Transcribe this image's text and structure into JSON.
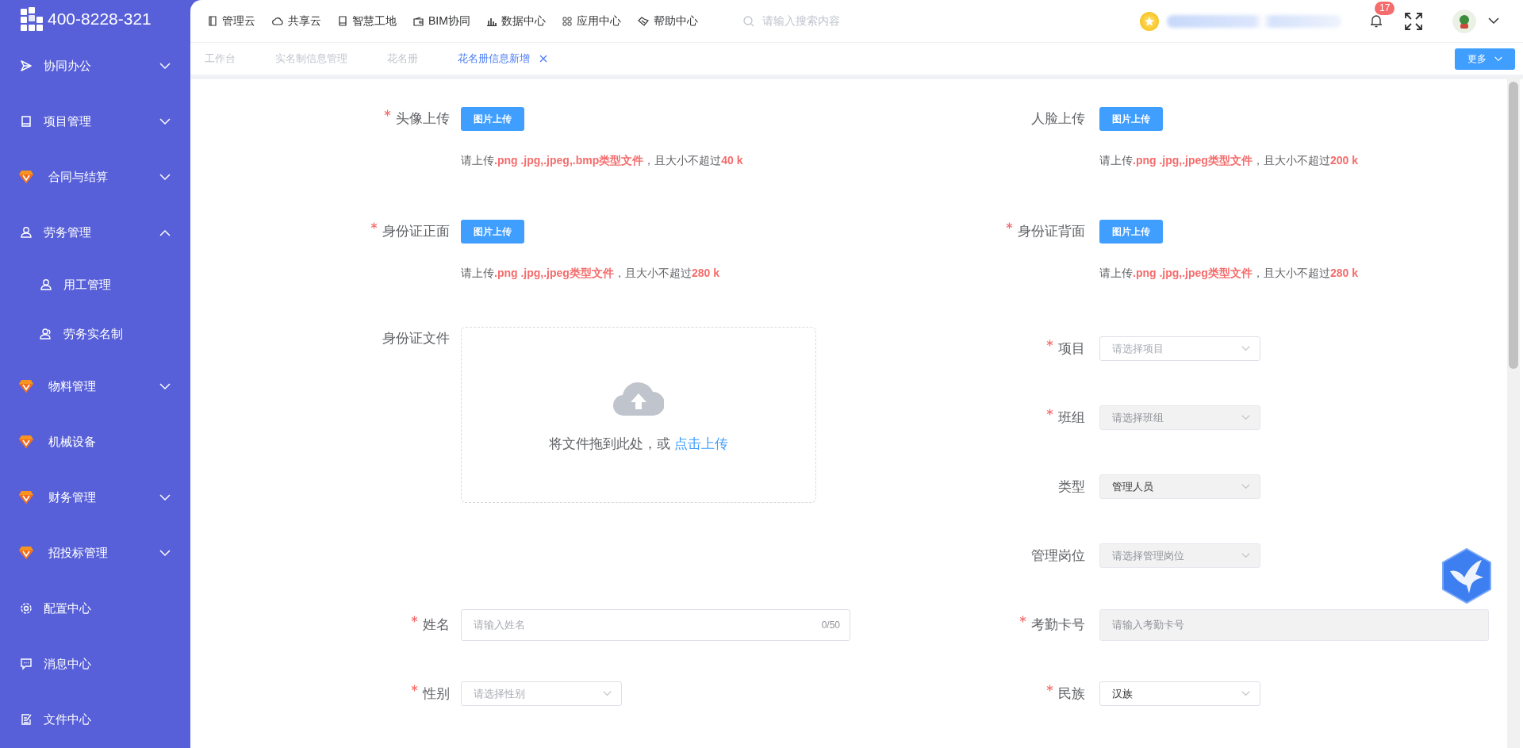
{
  "sidebar": {
    "logo_text": "400-8228-321",
    "items": [
      {
        "label": "协同办公",
        "expanded": false
      },
      {
        "label": "项目管理",
        "expanded": false
      },
      {
        "label": "合同与结算",
        "expanded": false
      },
      {
        "label": "劳务管理",
        "expanded": true,
        "children": [
          {
            "label": "用工管理"
          },
          {
            "label": "劳务实名制"
          }
        ]
      },
      {
        "label": "物料管理",
        "expanded": false
      },
      {
        "label": "机械设备"
      },
      {
        "label": "财务管理",
        "expanded": false
      },
      {
        "label": "招投标管理",
        "expanded": false
      },
      {
        "label": "配置中心"
      },
      {
        "label": "消息中心"
      },
      {
        "label": "文件中心"
      }
    ]
  },
  "header": {
    "nav": [
      {
        "label": "管理云"
      },
      {
        "label": "共享云"
      },
      {
        "label": "智慧工地"
      },
      {
        "label": "BIM协同"
      },
      {
        "label": "数据中心"
      },
      {
        "label": "应用中心"
      },
      {
        "label": "帮助中心"
      }
    ],
    "search": {
      "placeholder": "请输入搜索内容"
    },
    "notification_count": "17"
  },
  "tabs": [
    {
      "label": "工作台",
      "selected": false,
      "closable": false
    },
    {
      "label": "实名制信息管理",
      "selected": false,
      "closable": false
    },
    {
      "label": "花名册",
      "selected": false,
      "closable": false
    },
    {
      "label": "花名册信息新增",
      "selected": true,
      "closable": true
    }
  ],
  "more_button": "更多",
  "form": {
    "left": [
      {
        "kind": "image-upload",
        "label": "头像上传",
        "required": true,
        "button": "图片上传",
        "hint": "请上传**.png .jpg,.jpeg,.bmp类型文件**，且大小不超过**40 k**"
      },
      {
        "kind": "image-upload",
        "label": "身份证正面",
        "required": true,
        "button": "图片上传",
        "hint": "请上传**.png .jpg,.jpeg类型文件**，且大小不超过**280 k**"
      },
      {
        "kind": "dragger",
        "label": "身份证文件",
        "required": false,
        "text": "将文件拖到此处，或 ",
        "link": "点击上传"
      },
      {
        "kind": "input",
        "label": "姓名",
        "required": true,
        "placeholder": "请输入姓名",
        "counter": "0/50",
        "disabled": false
      },
      {
        "kind": "select",
        "label": "性别",
        "required": true,
        "placeholder": "请选择性别",
        "disabled": false
      }
    ],
    "right": [
      {
        "kind": "image-upload",
        "label": "人脸上传",
        "required": false,
        "button": "图片上传",
        "hint": "请上传**.png .jpg,.jpeg类型文件**，且大小不超过**200 k**"
      },
      {
        "kind": "image-upload",
        "label": "身份证背面",
        "required": true,
        "button": "图片上传",
        "hint": "请上传**.png .jpg,.jpeg类型文件**，且大小不超过**280 k**"
      },
      {
        "kind": "select",
        "label": "项目",
        "required": true,
        "placeholder": "请选择项目",
        "disabled": false
      },
      {
        "kind": "select",
        "label": "班组",
        "required": true,
        "placeholder": "请选择班组",
        "disabled": true
      },
      {
        "kind": "select",
        "label": "类型",
        "required": false,
        "value": "管理人员",
        "disabled": true
      },
      {
        "kind": "select",
        "label": "管理岗位",
        "required": false,
        "placeholder": "请选择管理岗位",
        "disabled": true
      },
      {
        "kind": "input",
        "label": "考勤卡号",
        "required": true,
        "placeholder": "请输入考勤卡号",
        "disabled": true
      },
      {
        "kind": "select",
        "label": "民族",
        "required": true,
        "value": "汉族",
        "disabled": false
      }
    ]
  }
}
